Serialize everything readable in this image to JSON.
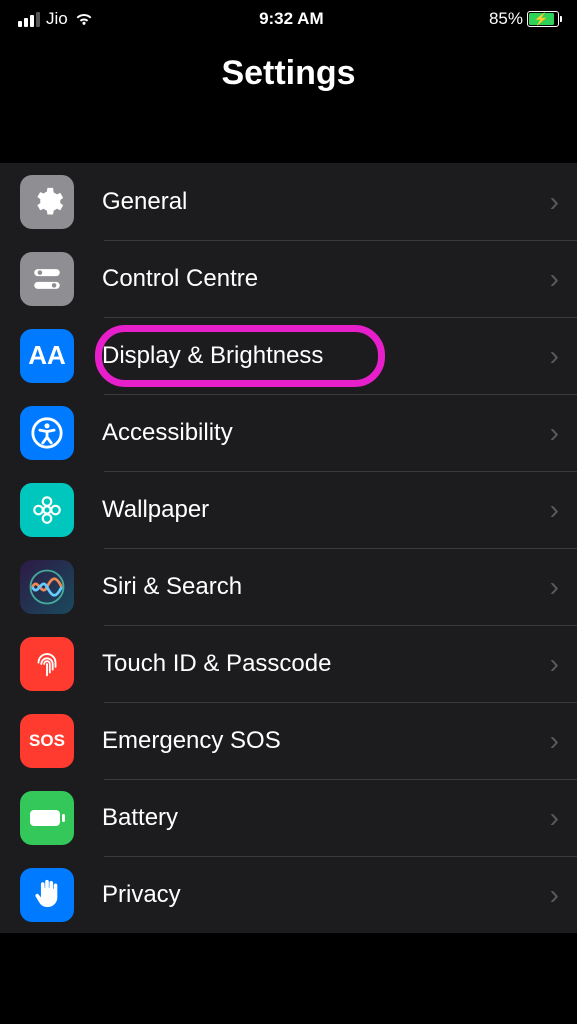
{
  "status": {
    "carrier": "Jio",
    "time": "9:32 AM",
    "battery_pct": "85%"
  },
  "header": {
    "title": "Settings"
  },
  "rows": {
    "general": "General",
    "control": "Control Centre",
    "display": "Display & Brightness",
    "access": "Accessibility",
    "wallpaper": "Wallpaper",
    "siri": "Siri & Search",
    "touch": "Touch ID & Passcode",
    "sos_label": "Emergency SOS",
    "sos_icon": "SOS",
    "battery": "Battery",
    "privacy": "Privacy"
  }
}
